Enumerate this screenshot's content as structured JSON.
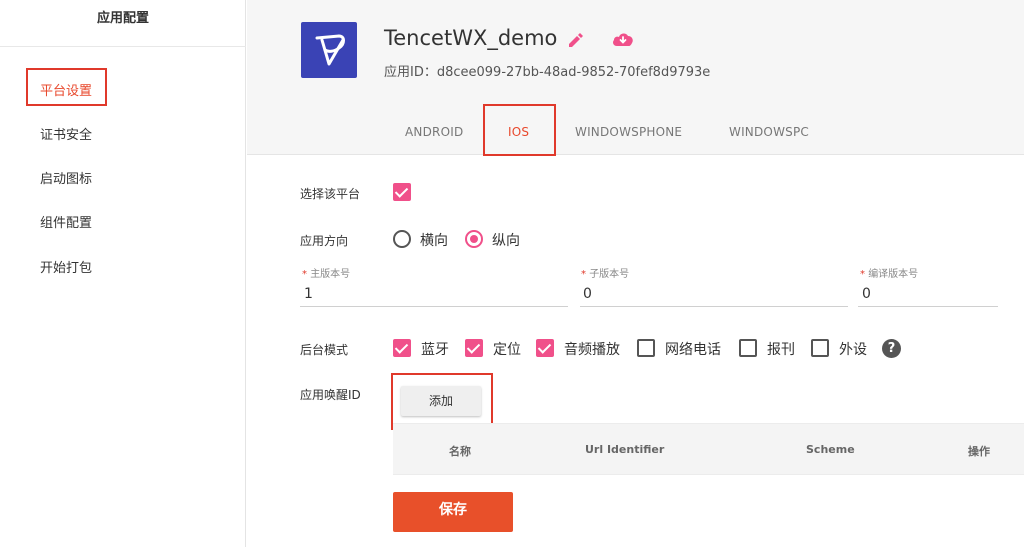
{
  "sidebar": {
    "title": "应用配置",
    "items": [
      {
        "label": "平台设置"
      },
      {
        "label": "证书安全"
      },
      {
        "label": "启动图标"
      },
      {
        "label": "组件配置"
      },
      {
        "label": "开始打包"
      }
    ]
  },
  "app": {
    "name": "TencetWX_demo",
    "id_line": "应用ID：d8cee099-27bb-48ad-9852-70fef8d9793e",
    "logo_color": "#3a43b5"
  },
  "tabs": [
    {
      "label": "ANDROID"
    },
    {
      "label": "IOS",
      "active": true
    },
    {
      "label": "WINDOWSPHONE"
    },
    {
      "label": "WINDOWSPC"
    }
  ],
  "form": {
    "select_platform_label": "选择该平台",
    "select_platform_checked": true,
    "orientation_label": "应用方向",
    "orientation_options": [
      {
        "label": "横向",
        "selected": false
      },
      {
        "label": "纵向",
        "selected": true
      }
    ],
    "versions": [
      {
        "label": "主版本号",
        "value": "1"
      },
      {
        "label": "子版本号",
        "value": "0"
      },
      {
        "label": "编译版本号",
        "value": "0"
      }
    ],
    "background_mode_label": "后台模式",
    "background_modes": [
      {
        "label": "蓝牙",
        "checked": true
      },
      {
        "label": "定位",
        "checked": true
      },
      {
        "label": "音频播放",
        "checked": true
      },
      {
        "label": "网络电话",
        "checked": false
      },
      {
        "label": "报刊",
        "checked": false
      },
      {
        "label": "外设",
        "checked": false
      }
    ],
    "wake_id_label": "应用唤醒ID",
    "add_button": "添加",
    "table_headers": [
      "名称",
      "Url Identifier",
      "Scheme",
      "操作"
    ],
    "save_button": "保存"
  },
  "colors": {
    "accent": "#e8482c",
    "checkbox": "#f0508a",
    "annotation_box": "#e0392b"
  }
}
